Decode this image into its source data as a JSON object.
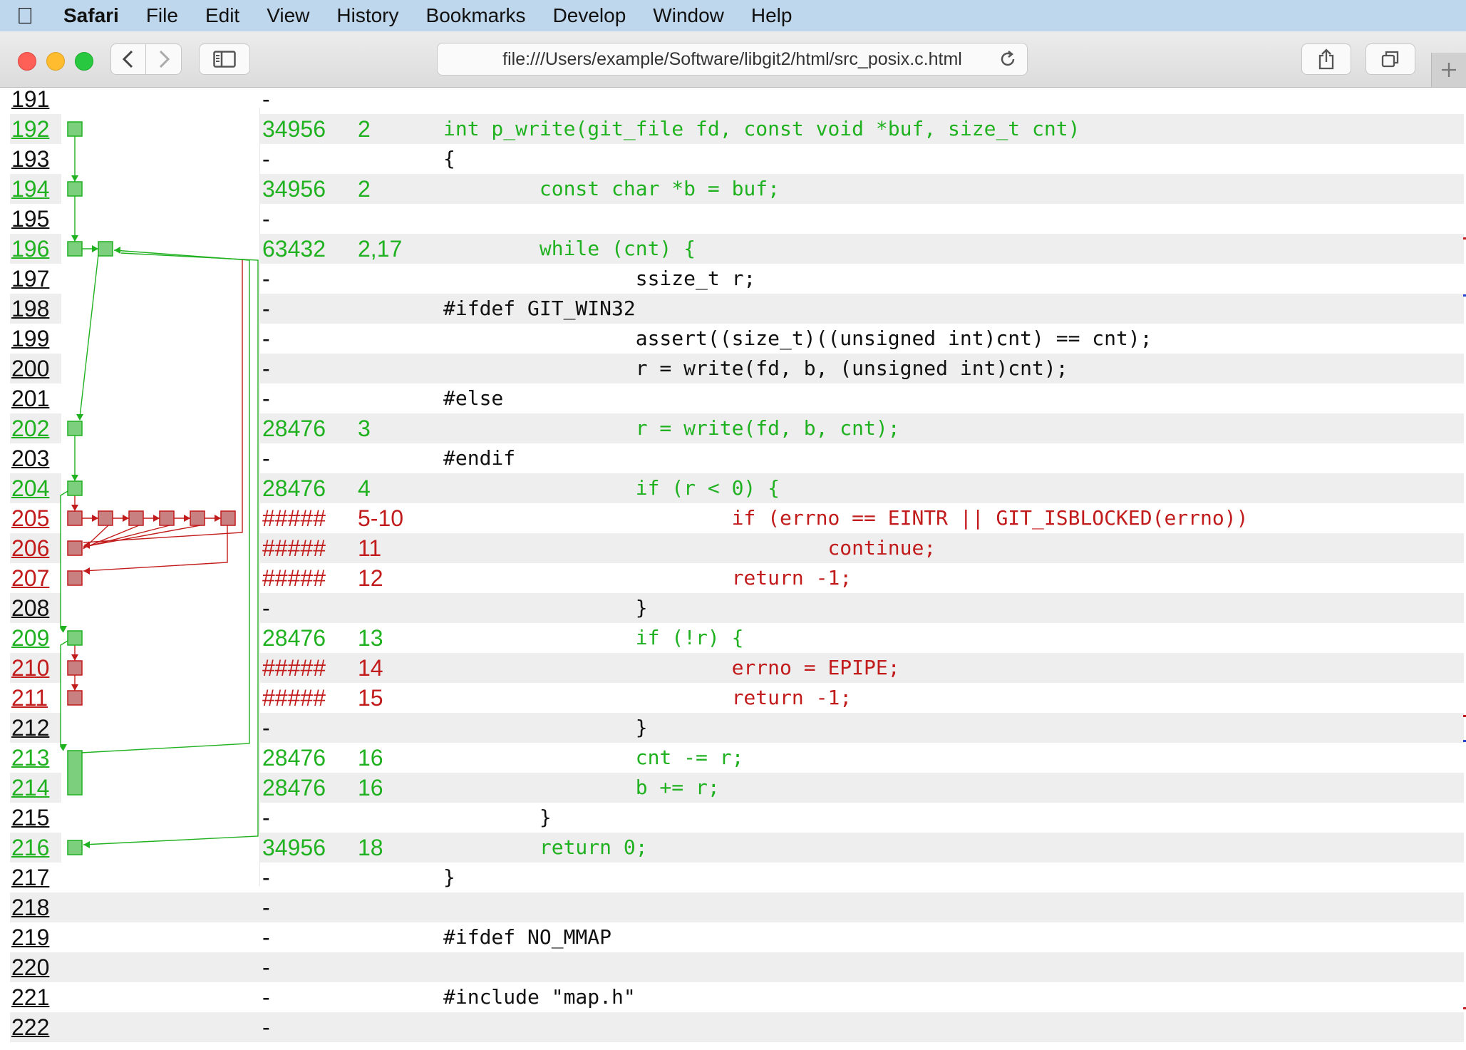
{
  "menubar": {
    "app": "Safari",
    "items": [
      "File",
      "Edit",
      "View",
      "History",
      "Bookmarks",
      "Develop",
      "Window",
      "Help"
    ]
  },
  "toolbar": {
    "url": "file:///Users/example/Software/libgit2/html/src_posix.c.html"
  },
  "colors": {
    "covered": "#1fb11f",
    "uncovered": "#c21b1b",
    "neutral": "#111111",
    "row_shade": "#eeeeee",
    "menubar_bg": "#bfd7ec"
  },
  "lines": [
    {
      "num": "191",
      "count": "-",
      "blocks": "",
      "code": "",
      "status": "none"
    },
    {
      "num": "192",
      "count": "34956",
      "blocks": "2",
      "code": "int p_write(git_file fd, const void *buf, size_t cnt)",
      "status": "covered"
    },
    {
      "num": "193",
      "count": "-",
      "blocks": "",
      "code": "{",
      "status": "none"
    },
    {
      "num": "194",
      "count": "34956",
      "blocks": "2",
      "code": "        const char *b = buf;",
      "status": "covered"
    },
    {
      "num": "195",
      "count": "-",
      "blocks": "",
      "code": "",
      "status": "none"
    },
    {
      "num": "196",
      "count": "63432",
      "blocks": "2,17",
      "code": "        while (cnt) {",
      "status": "covered"
    },
    {
      "num": "197",
      "count": "-",
      "blocks": "",
      "code": "                ssize_t r;",
      "status": "none"
    },
    {
      "num": "198",
      "count": "-",
      "blocks": "",
      "code": "#ifdef GIT_WIN32",
      "status": "none"
    },
    {
      "num": "199",
      "count": "-",
      "blocks": "",
      "code": "                assert((size_t)((unsigned int)cnt) == cnt);",
      "status": "none"
    },
    {
      "num": "200",
      "count": "-",
      "blocks": "",
      "code": "                r = write(fd, b, (unsigned int)cnt);",
      "status": "none"
    },
    {
      "num": "201",
      "count": "-",
      "blocks": "",
      "code": "#else",
      "status": "none"
    },
    {
      "num": "202",
      "count": "28476",
      "blocks": "3",
      "code": "                r = write(fd, b, cnt);",
      "status": "covered"
    },
    {
      "num": "203",
      "count": "-",
      "blocks": "",
      "code": "#endif",
      "status": "none"
    },
    {
      "num": "204",
      "count": "28476",
      "blocks": "4",
      "code": "                if (r < 0) {",
      "status": "covered"
    },
    {
      "num": "205",
      "count": "#####",
      "blocks": "5-10",
      "code": "                        if (errno == EINTR || GIT_ISBLOCKED(errno))",
      "status": "uncovered"
    },
    {
      "num": "206",
      "count": "#####",
      "blocks": "11",
      "code": "                                continue;",
      "status": "uncovered"
    },
    {
      "num": "207",
      "count": "#####",
      "blocks": "12",
      "code": "                        return -1;",
      "status": "uncovered"
    },
    {
      "num": "208",
      "count": "-",
      "blocks": "",
      "code": "                }",
      "status": "none"
    },
    {
      "num": "209",
      "count": "28476",
      "blocks": "13",
      "code": "                if (!r) {",
      "status": "covered"
    },
    {
      "num": "210",
      "count": "#####",
      "blocks": "14",
      "code": "                        errno = EPIPE;",
      "status": "uncovered"
    },
    {
      "num": "211",
      "count": "#####",
      "blocks": "15",
      "code": "                        return -1;",
      "status": "uncovered"
    },
    {
      "num": "212",
      "count": "-",
      "blocks": "",
      "code": "                }",
      "status": "none"
    },
    {
      "num": "213",
      "count": "28476",
      "blocks": "16",
      "code": "                cnt -= r;",
      "status": "covered"
    },
    {
      "num": "214",
      "count": "28476",
      "blocks": "16",
      "code": "                b += r;",
      "status": "covered"
    },
    {
      "num": "215",
      "count": "-",
      "blocks": "",
      "code": "        }",
      "status": "none"
    },
    {
      "num": "216",
      "count": "34956",
      "blocks": "18",
      "code": "        return 0;",
      "status": "covered"
    },
    {
      "num": "217",
      "count": "-",
      "blocks": "",
      "code": "}",
      "status": "none"
    },
    {
      "num": "218",
      "count": "-",
      "blocks": "",
      "code": "",
      "status": "none"
    },
    {
      "num": "219",
      "count": "-",
      "blocks": "",
      "code": "#ifdef NO_MMAP",
      "status": "none"
    },
    {
      "num": "220",
      "count": "-",
      "blocks": "",
      "code": "",
      "status": "none"
    },
    {
      "num": "221",
      "count": "-",
      "blocks": "",
      "code": "#include \"map.h\"",
      "status": "none"
    },
    {
      "num": "222",
      "count": "-",
      "blocks": "",
      "code": "",
      "status": "none"
    }
  ]
}
